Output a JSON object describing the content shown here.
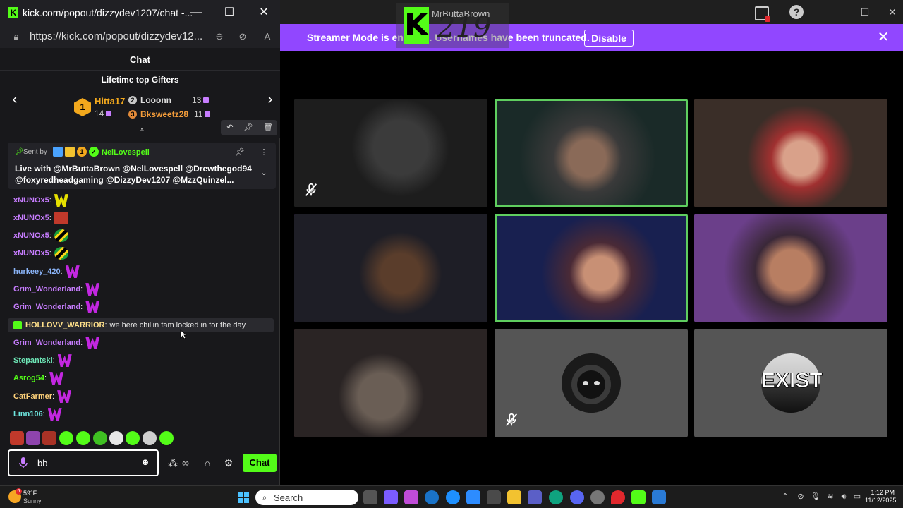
{
  "popout": {
    "title": "kick.com/popout/dizzydev1207/chat -...",
    "url": "https://kick.com/popout/dizzydev12...",
    "chat_header": "Chat"
  },
  "gifters": {
    "title": "Lifetime top Gifters",
    "first": {
      "rank": "1",
      "name": "Hitta17",
      "count": "14"
    },
    "second": {
      "rank": "2",
      "name": "Looonn",
      "count": "13"
    },
    "third": {
      "rank": "3",
      "name": "Bksweetz28",
      "count": "11"
    }
  },
  "pinned": {
    "sent_by": "Sent by",
    "badge_sub": "1",
    "sender": "NelLovespell",
    "text": "Live with @MrButtaBrown @NelLovespell @Drewthegod94 @foxyredheadgaming @DizzyDev1207 @MzzQuinzel..."
  },
  "messages": [
    {
      "user": "xNUNOx5",
      "sep": ":",
      "color": "#c77dff",
      "emote": "em-wy",
      "text": ""
    },
    {
      "user": "xNUNOx5",
      "sep": ":",
      "color": "#c77dff",
      "emote": "em-vibes",
      "text": ""
    },
    {
      "user": "xNUNOx5",
      "sep": ":",
      "color": "#c77dff",
      "emote": "em-jam",
      "text": ""
    },
    {
      "user": "xNUNOx5",
      "sep": ":",
      "color": "#c77dff",
      "emote": "em-jam",
      "text": ""
    },
    {
      "user": "hurkeey_420",
      "sep": ":",
      "color": "#8ab4f8",
      "emote": "em-w",
      "text": ""
    },
    {
      "user": "Grim_Wonderland",
      "sep": ":",
      "color": "#c77dff",
      "emote": "em-w",
      "text": ""
    },
    {
      "user": "Grim_Wonderland",
      "sep": ":",
      "color": "#c77dff",
      "emote": "em-w",
      "text": ""
    },
    {
      "user": "HOLLOVV_WARRIOR",
      "sep": ":",
      "color": "#ffe08a",
      "emote": "",
      "text": "we here chillin fam locked in for the day"
    },
    {
      "user": "Grim_Wonderland",
      "sep": ":",
      "color": "#c77dff",
      "emote": "em-w",
      "text": ""
    },
    {
      "user": "Stepantski",
      "sep": ":",
      "color": "#6ee7b7",
      "emote": "em-w",
      "text": ""
    },
    {
      "user": "Asrog54",
      "sep": ":",
      "color": "#53fc18",
      "emote": "em-w",
      "text": ""
    },
    {
      "user": "CatFarmer",
      "sep": ":",
      "color": "#ffd27a",
      "emote": "em-w",
      "text": ""
    },
    {
      "user": "Linn106",
      "sep": ":",
      "color": "#6ee7e0",
      "emote": "em-w",
      "text": ""
    }
  ],
  "input": {
    "value": "bb",
    "send_label": "Chat"
  },
  "banner": {
    "text": "Streamer Mode is enabled. Usernames have been truncated.",
    "button": "Disable"
  },
  "bg_app": {
    "logo_number": "219",
    "logo_name": "MrButtaBrown"
  },
  "taskbar": {
    "weather_badge": "6",
    "temp": "59°F",
    "condition": "Sunny",
    "search_placeholder": "Search",
    "time": "1:12 PM",
    "date": "11/12/2025"
  },
  "colors": {
    "kick_green": "#53fc18",
    "banner_purple": "#9147ff",
    "speaker_border": "#5fce5f"
  }
}
